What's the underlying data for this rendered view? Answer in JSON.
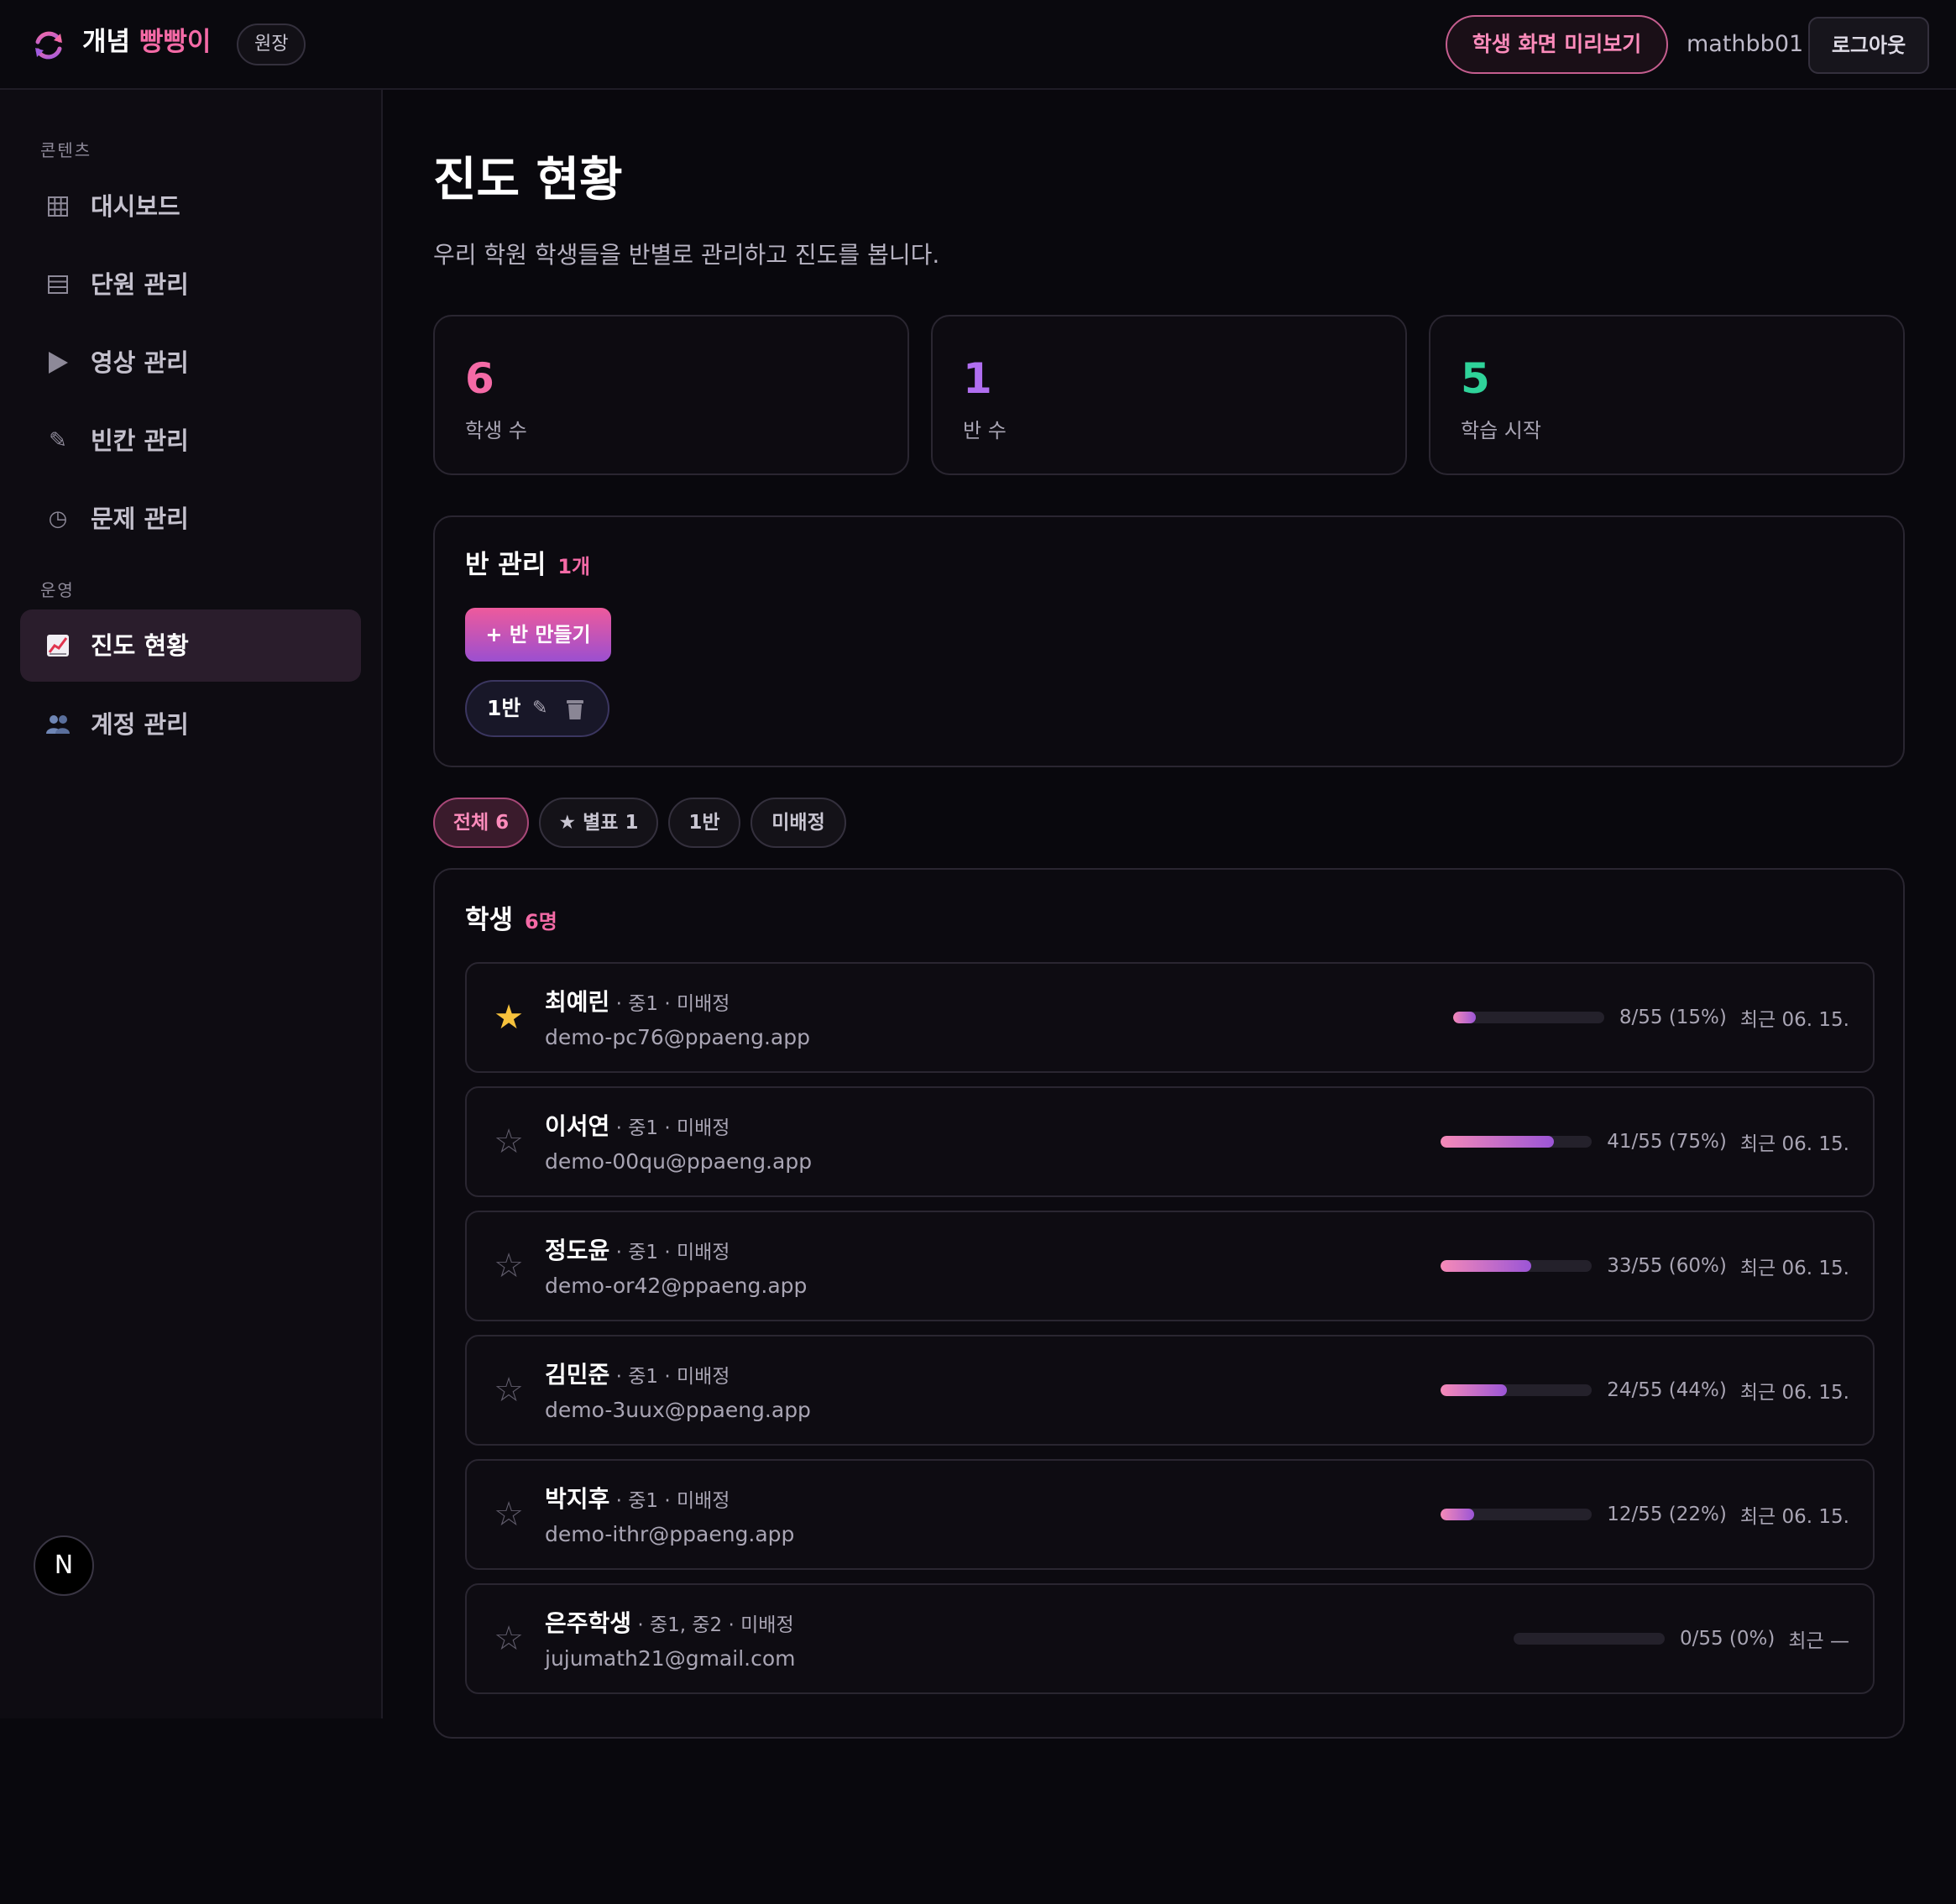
{
  "header": {
    "brand_main": "개념 ",
    "brand_accent": "빵빵이",
    "role": "원장",
    "preview_button": "학생 화면 미리보기",
    "username": "mathbb01",
    "logout_button": "로그아웃"
  },
  "sidebar": {
    "section_content": "콘텐츠",
    "section_ops": "운영",
    "items": [
      {
        "label": "대시보드",
        "icon": "grid-icon"
      },
      {
        "label": "단원 관리",
        "icon": "list-icon"
      },
      {
        "label": "영상 관리",
        "icon": "play-icon"
      },
      {
        "label": "빈칸 관리",
        "icon": "pencil-icon"
      },
      {
        "label": "문제 관리",
        "icon": "clock-icon"
      },
      {
        "label": "진도 현황",
        "icon": "chart-icon",
        "active": true
      },
      {
        "label": "계정 관리",
        "icon": "users-icon"
      }
    ],
    "footer_badge": "N"
  },
  "page": {
    "title": "진도 현황",
    "subtitle": "우리 학원 학생들을 반별로 관리하고 진도를 봅니다."
  },
  "stats": [
    {
      "value": "6",
      "label": "학생 수",
      "color": "#f46aa6"
    },
    {
      "value": "1",
      "label": "반 수",
      "color": "#b06ef0"
    },
    {
      "value": "5",
      "label": "학습 시작",
      "color": "#2fd39a"
    }
  ],
  "classes": {
    "title": "반 관리",
    "count": "1개",
    "create_button": "+ 반 만들기",
    "items": [
      {
        "name": "1반"
      }
    ]
  },
  "filters": [
    {
      "label": "전체 6",
      "active": true
    },
    {
      "label": "★ 별표 1"
    },
    {
      "label": "1반"
    },
    {
      "label": "미배정"
    }
  ],
  "students": {
    "title": "학생",
    "count": "6명",
    "rows": [
      {
        "name": "최예린",
        "meta": " · 중1 · 미배정",
        "email": "demo-pc76@ppaeng.app",
        "progress": 0.15,
        "progress_text": "8/55 (15%)",
        "recent": "최근 06. 15.",
        "starred": true
      },
      {
        "name": "이서연",
        "meta": " · 중1 · 미배정",
        "email": "demo-00qu@ppaeng.app",
        "progress": 0.75,
        "progress_text": "41/55 (75%)",
        "recent": "최근 06. 15.",
        "starred": false
      },
      {
        "name": "정도윤",
        "meta": " · 중1 · 미배정",
        "email": "demo-or42@ppaeng.app",
        "progress": 0.6,
        "progress_text": "33/55 (60%)",
        "recent": "최근 06. 15.",
        "starred": false
      },
      {
        "name": "김민준",
        "meta": " · 중1 · 미배정",
        "email": "demo-3uux@ppaeng.app",
        "progress": 0.44,
        "progress_text": "24/55 (44%)",
        "recent": "최근 06. 15.",
        "starred": false
      },
      {
        "name": "박지후",
        "meta": " · 중1 · 미배정",
        "email": "demo-ithr@ppaeng.app",
        "progress": 0.22,
        "progress_text": "12/55 (22%)",
        "recent": "최근 06. 15.",
        "starred": false
      },
      {
        "name": "은주학생",
        "meta": " · 중1, 중2 · 미배정",
        "email": "jujumath21@gmail.com",
        "progress": 0.0,
        "progress_text": "0/55 (0%)",
        "recent": "최근 —",
        "starred": false
      }
    ]
  }
}
